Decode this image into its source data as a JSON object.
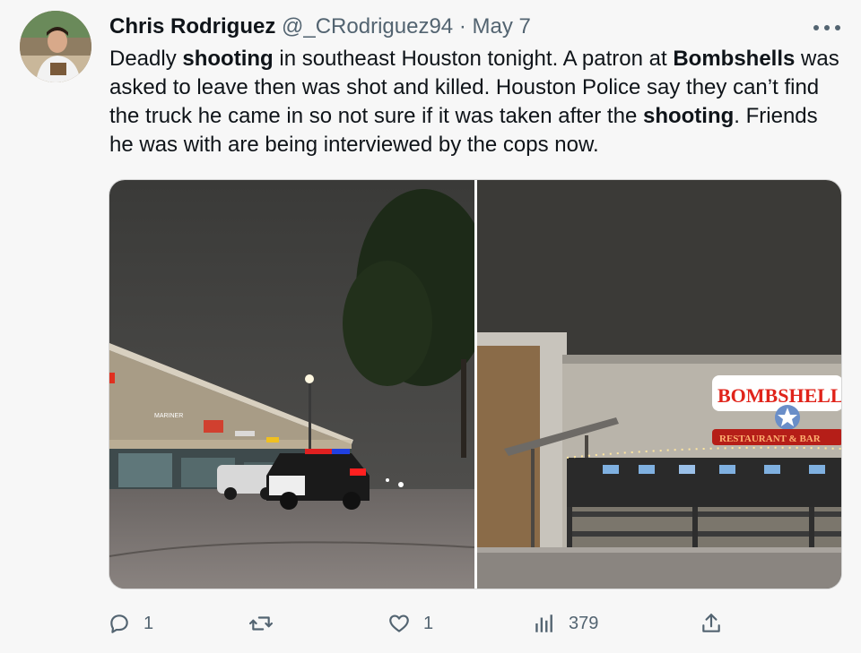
{
  "tweet": {
    "author_name": "Chris Rodriguez",
    "handle": "@_CRodriguez94",
    "separator": "·",
    "date": "May 7",
    "text_segments": [
      {
        "t": "Deadly ",
        "bold": false
      },
      {
        "t": "shooting",
        "bold": true
      },
      {
        "t": " in southeast Houston tonight. A patron at ",
        "bold": false
      },
      {
        "t": "Bombshells",
        "bold": true
      },
      {
        "t": " was asked to leave then was shot and killed. Houston Police say they can’t find the truck he came in so not sure if it was taken after the ",
        "bold": false
      },
      {
        "t": "shooting",
        "bold": true
      },
      {
        "t": ". Friends he was with are being interviewed by the cops now.",
        "bold": false
      }
    ]
  },
  "media": {
    "left_photo": {
      "storefront_signs": [
        "MARINER",
        "ERS",
        "",
        ""
      ]
    },
    "right_photo": {
      "sign_main": "BOMBSHELLS",
      "sign_sub": "RESTAURANT & BAR"
    }
  },
  "actions": {
    "reply_count": "1",
    "retweet_count": "",
    "like_count": "1",
    "views_count": "379"
  },
  "colors": {
    "text_primary": "#0f1419",
    "text_secondary": "#536471",
    "background": "#f7f7f7",
    "bombshells_red": "#e0241b"
  },
  "icons": [
    "more-icon",
    "reply-icon",
    "retweet-icon",
    "like-icon",
    "views-icon",
    "share-icon"
  ]
}
